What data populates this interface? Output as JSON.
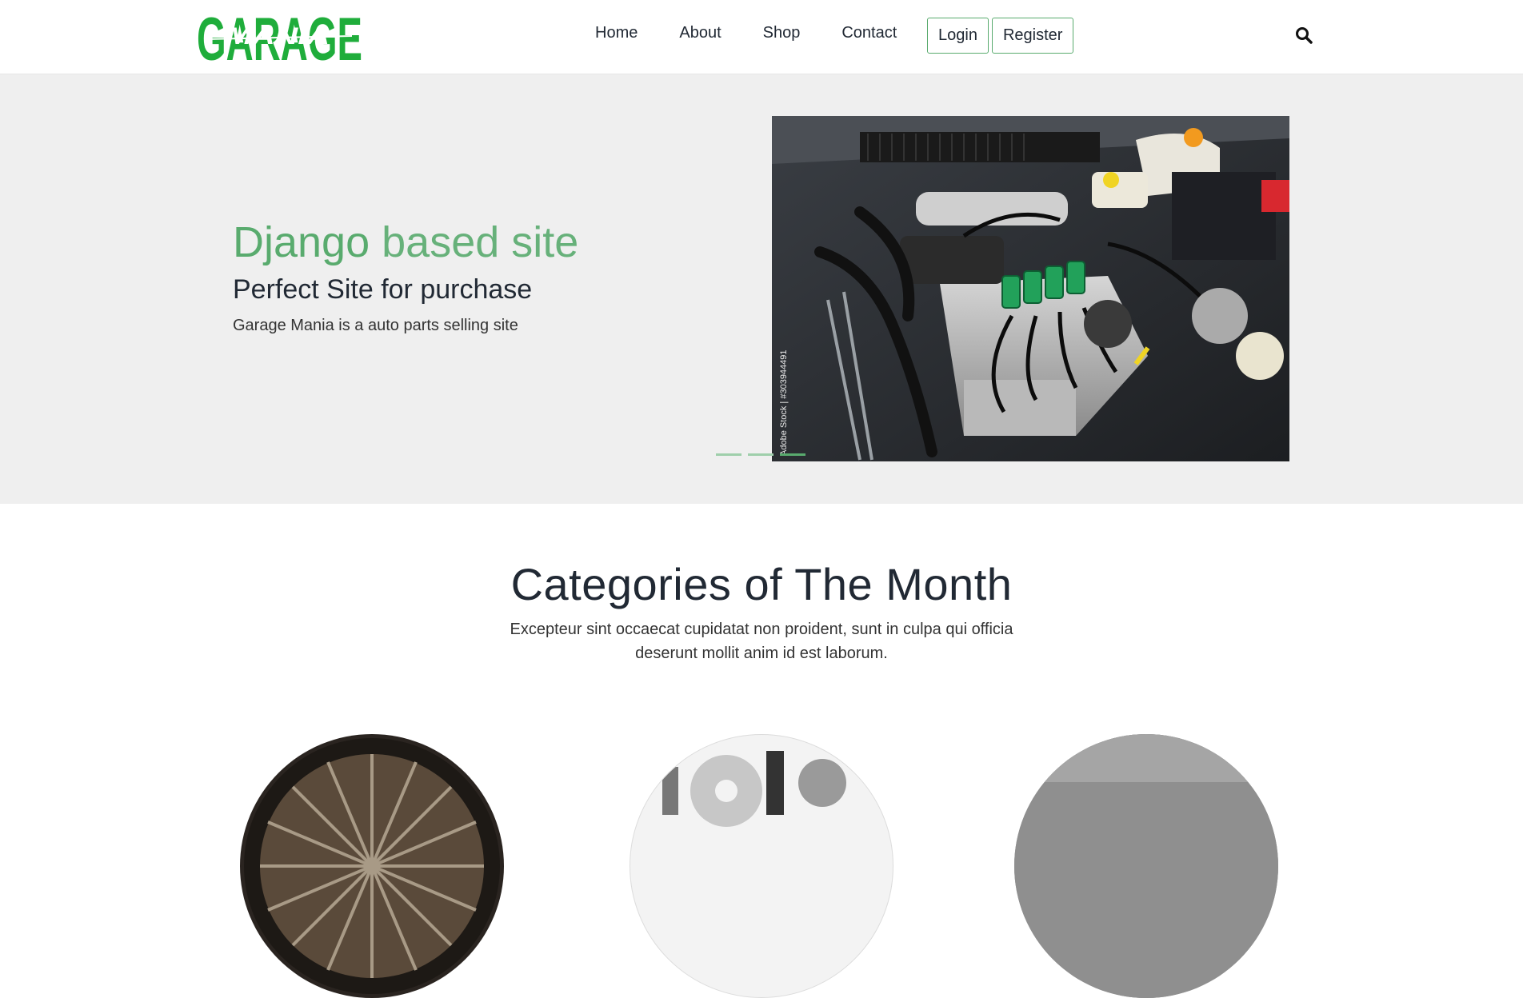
{
  "brand": {
    "logo_word_top": "GARAGE",
    "logo_word_overlay": "MANIA",
    "color": "#1fad3b"
  },
  "nav": {
    "links": [
      "Home",
      "About",
      "Shop",
      "Contact"
    ],
    "login_label": "Login",
    "register_label": "Register",
    "search_icon": "search-icon"
  },
  "hero": {
    "title_strong": "Django",
    "title_light": "based site",
    "subtitle": "Perfect Site for purchase",
    "description": "Garage Mania is a auto parts selling site",
    "image_watermark": "Adobe Stock | #303944491",
    "slides": 3,
    "active_slide": 3,
    "accent_color": "#59ab6e"
  },
  "categories": {
    "title": "Categories of The Month",
    "description": "Excepteur sint occaecat cupidatat non proident, sunt in culpa qui officia deserunt mollit anim id est laborum."
  }
}
